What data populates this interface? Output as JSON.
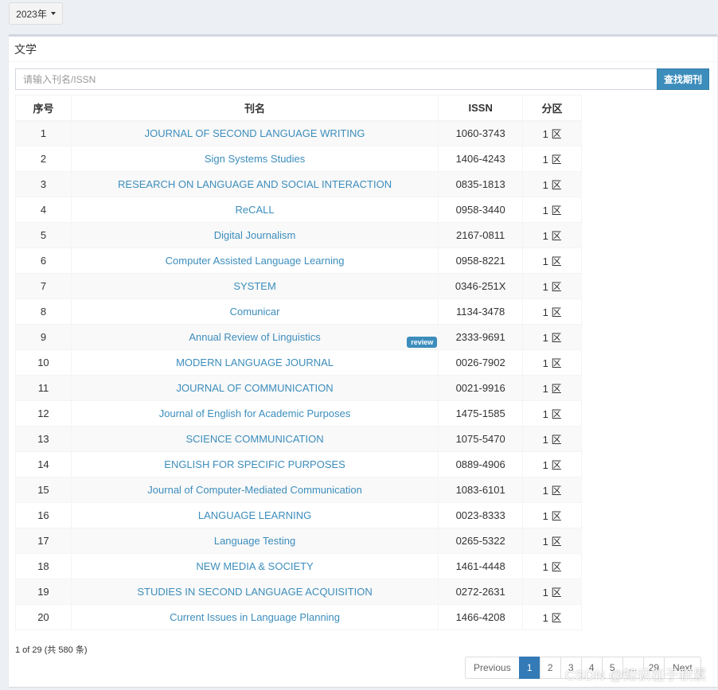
{
  "year_dropdown": {
    "label": "2023年"
  },
  "panel": {
    "title": "文学"
  },
  "search": {
    "placeholder": "请输入刊名/ISSN",
    "button_label": "查找期刊"
  },
  "table": {
    "headers": {
      "no": "序号",
      "name": "刊名",
      "issn": "ISSN",
      "zone": "分区"
    },
    "rows": [
      {
        "no": "1",
        "name": "JOURNAL OF SECOND LANGUAGE WRITING",
        "issn": "1060-3743",
        "zone": "1 区"
      },
      {
        "no": "2",
        "name": "Sign Systems Studies",
        "issn": "1406-4243",
        "zone": "1 区"
      },
      {
        "no": "3",
        "name": "RESEARCH ON LANGUAGE AND SOCIAL INTERACTION",
        "issn": "0835-1813",
        "zone": "1 区"
      },
      {
        "no": "4",
        "name": "ReCALL",
        "issn": "0958-3440",
        "zone": "1 区"
      },
      {
        "no": "5",
        "name": "Digital Journalism",
        "issn": "2167-0811",
        "zone": "1 区"
      },
      {
        "no": "6",
        "name": "Computer Assisted Language Learning",
        "issn": "0958-8221",
        "zone": "1 区"
      },
      {
        "no": "7",
        "name": "SYSTEM",
        "issn": "0346-251X",
        "zone": "1 区"
      },
      {
        "no": "8",
        "name": "Comunicar",
        "issn": "1134-3478",
        "zone": "1 区"
      },
      {
        "no": "9",
        "name": "Annual Review of Linguistics",
        "issn": "2333-9691",
        "zone": "1 区",
        "badge": "review"
      },
      {
        "no": "10",
        "name": "MODERN LANGUAGE JOURNAL",
        "issn": "0026-7902",
        "zone": "1 区"
      },
      {
        "no": "11",
        "name": "JOURNAL OF COMMUNICATION",
        "issn": "0021-9916",
        "zone": "1 区"
      },
      {
        "no": "12",
        "name": "Journal of English for Academic Purposes",
        "issn": "1475-1585",
        "zone": "1 区"
      },
      {
        "no": "13",
        "name": "SCIENCE COMMUNICATION",
        "issn": "1075-5470",
        "zone": "1 区"
      },
      {
        "no": "14",
        "name": "ENGLISH FOR SPECIFIC PURPOSES",
        "issn": "0889-4906",
        "zone": "1 区"
      },
      {
        "no": "15",
        "name": "Journal of Computer-Mediated Communication",
        "issn": "1083-6101",
        "zone": "1 区"
      },
      {
        "no": "16",
        "name": "LANGUAGE LEARNING",
        "issn": "0023-8333",
        "zone": "1 区"
      },
      {
        "no": "17",
        "name": "Language Testing",
        "issn": "0265-5322",
        "zone": "1 区"
      },
      {
        "no": "18",
        "name": "NEW MEDIA & SOCIETY",
        "issn": "1461-4448",
        "zone": "1 区"
      },
      {
        "no": "19",
        "name": "STUDIES IN SECOND LANGUAGE ACQUISITION",
        "issn": "0272-2631",
        "zone": "1 区"
      },
      {
        "no": "20",
        "name": "Current Issues in Language Planning",
        "issn": "1466-4208",
        "zone": "1 区"
      }
    ]
  },
  "summary": "1 of 29 (共 580 条)",
  "pagination": {
    "previous": "Previous",
    "pages": [
      "1",
      "2",
      "3",
      "4",
      "5",
      "...",
      "29"
    ],
    "active": "1",
    "next": "Next"
  },
  "watermark": "CSDN @知识在于积累",
  "colors": {
    "accent": "#3c8dbc",
    "active_page": "#337ab7",
    "background": "#ecf0f5"
  }
}
